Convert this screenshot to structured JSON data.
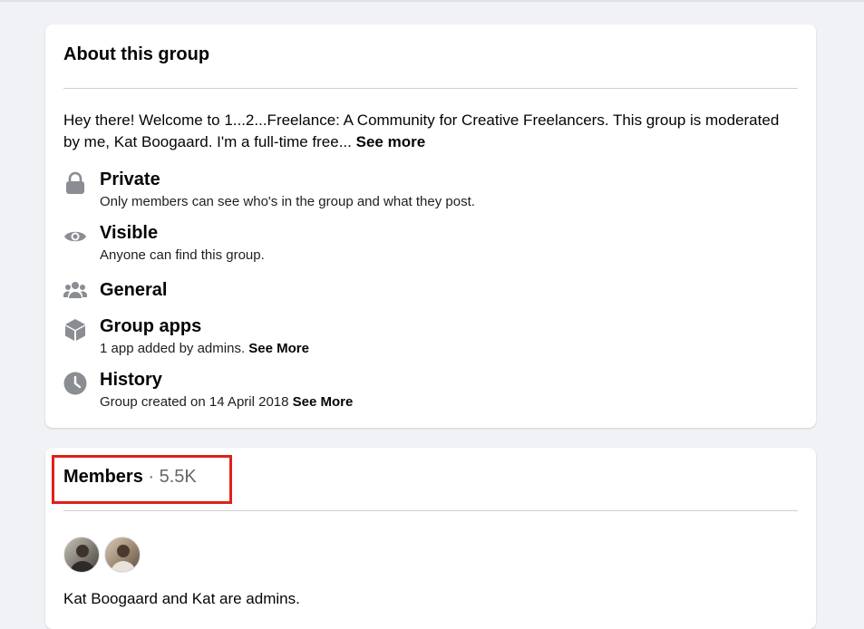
{
  "about": {
    "title": "About this group",
    "description": "Hey there! Welcome to 1...2...Freelance: A Community for Creative Freelancers. This group is moderated by me, Kat Boogaard. I'm a full-time free... ",
    "see_more": "See more",
    "items": [
      {
        "icon": "lock-icon",
        "title": "Private",
        "subtitle": "Only members can see who's in the group and what they post.",
        "link": ""
      },
      {
        "icon": "eye-icon",
        "title": "Visible",
        "subtitle": "Anyone can find this group.",
        "link": ""
      },
      {
        "icon": "people-icon",
        "title": "General",
        "subtitle": "",
        "link": ""
      },
      {
        "icon": "cube-icon",
        "title": "Group apps",
        "subtitle": "1 app added by admins. ",
        "link": "See More"
      },
      {
        "icon": "clock-icon",
        "title": "History",
        "subtitle": "Group created on 14 April 2018 ",
        "link": "See More"
      }
    ]
  },
  "members": {
    "title": "Members",
    "separator": "·",
    "count": "5.5K",
    "admins_text": "Kat Boogaard and Kat are admins."
  },
  "colors": {
    "background": "#f0f2f5",
    "card": "#ffffff",
    "icon_gray": "#8a8d91",
    "highlight": "#e0201b"
  }
}
